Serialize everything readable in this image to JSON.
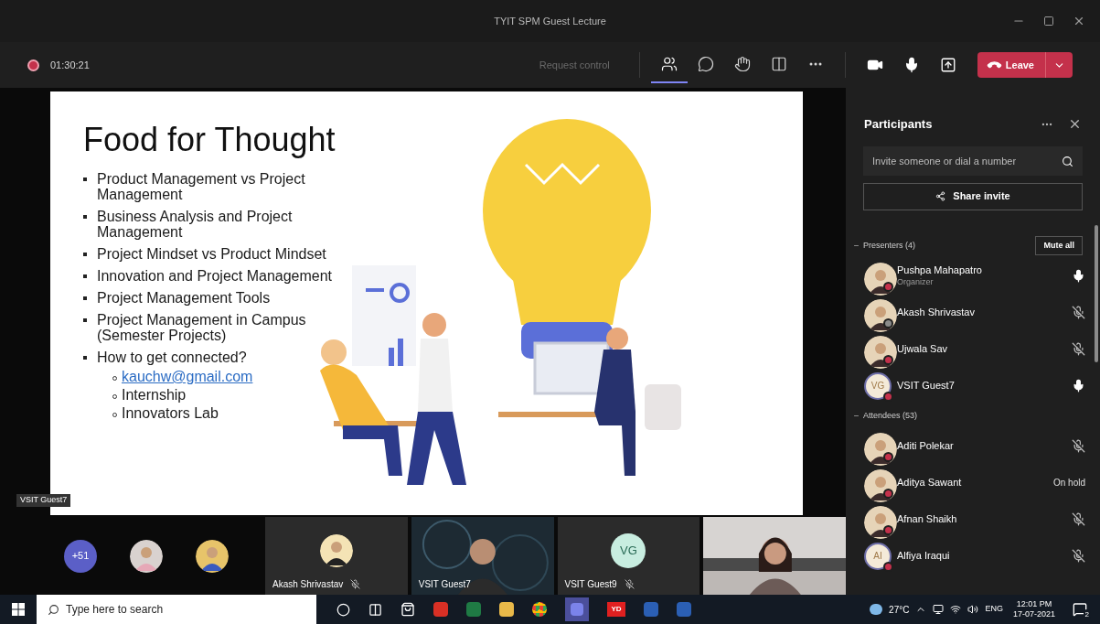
{
  "window": {
    "title": "TYIT SPM Guest Lecture"
  },
  "toolbar": {
    "recording": true,
    "timer": "01:30:21",
    "request_control": {
      "label": "Request control",
      "disabled": true
    },
    "tools": [
      {
        "kind": "participants",
        "selected": true
      },
      {
        "kind": "chat",
        "selected": false
      },
      {
        "kind": "reactions",
        "selected": false
      },
      {
        "kind": "rooms",
        "selected": false
      },
      {
        "kind": "more",
        "selected": false
      }
    ],
    "devices": [
      {
        "kind": "camera"
      },
      {
        "kind": "mic"
      },
      {
        "kind": "share"
      }
    ],
    "leave": "Leave"
  },
  "slide": {
    "title": "Food for Thought",
    "bullets": [
      {
        "text": "Product Management vs Project Management"
      },
      {
        "text": "Business Analysis and Project Management"
      },
      {
        "text": "Project Mindset vs Product Mindset"
      },
      {
        "text": "Innovation and Project Management"
      },
      {
        "text": "Project Management Tools"
      },
      {
        "text": "Project Management in Campus (Semester Projects)"
      },
      {
        "text": "How to get connected?",
        "children": [
          {
            "text": "kauchw@gmail.com",
            "kind": "link"
          },
          {
            "text": "Internship",
            "kind": "text"
          },
          {
            "text": "Innovators Lab",
            "kind": "text"
          }
        ]
      }
    ]
  },
  "speaker_label": "VSIT Guest7",
  "gallery": {
    "overflow": "+51",
    "tiles": [
      {
        "kind": "avatar",
        "name": "Akash Shrivastav",
        "muted": true
      },
      {
        "kind": "video",
        "name": "VSIT Guest7",
        "muted": false
      },
      {
        "kind": "initials",
        "initials": "VG",
        "name": "VSIT Guest9",
        "muted": true
      },
      {
        "kind": "video"
      }
    ]
  },
  "participants": {
    "title": "Participants",
    "search": {
      "placeholder": "Invite someone or dial a number"
    },
    "share_invite": "Share invite",
    "groups": [
      {
        "label": "Presenters (4)",
        "expanded": true,
        "action": "Mute all",
        "members": [
          {
            "name": "Pushpa Mahapatro",
            "subtitle": "Organizer",
            "busy": true,
            "kind": "mic",
            "muted": false
          },
          {
            "name": "Akash Shrivastav",
            "busy": false,
            "kind": "mic",
            "muted": true
          },
          {
            "name": "Ujwala Sav",
            "busy": true,
            "kind": "mic",
            "muted": true
          },
          {
            "name": "VSIT Guest7",
            "avatar": {
              "kind": "initials",
              "initials": "VG"
            },
            "busy": true,
            "kind": "mic",
            "muted": false
          }
        ]
      },
      {
        "label": "Attendees (53)",
        "expanded": true,
        "members": [
          {
            "name": "Aditi Polekar",
            "busy": true,
            "kind": "mic",
            "muted": true
          },
          {
            "name": "Aditya Sawant",
            "busy": true,
            "kind": "status",
            "status": "On hold"
          },
          {
            "name": "Afnan Shaikh",
            "busy": true,
            "kind": "mic",
            "muted": true
          },
          {
            "name": "Alfiya Iraqui",
            "avatar": {
              "kind": "initials",
              "initials": "AI"
            },
            "busy": true,
            "kind": "mic",
            "muted": true
          }
        ]
      }
    ]
  },
  "taskbar": {
    "search_placeholder": "Type here to search",
    "apps": [
      {
        "kind": "cortana"
      },
      {
        "kind": "taskview"
      },
      {
        "kind": "store"
      },
      {
        "kind": "pdf"
      },
      {
        "kind": "excel"
      },
      {
        "kind": "explorer"
      },
      {
        "kind": "chrome"
      },
      {
        "kind": "teams"
      },
      {
        "kind": "badge",
        "label": "YD"
      },
      {
        "kind": "word"
      },
      {
        "kind": "word"
      }
    ],
    "weather": "27°C",
    "language": "ENG",
    "time": "12:01 PM",
    "date": "17-07-2021",
    "notifications": "2"
  }
}
